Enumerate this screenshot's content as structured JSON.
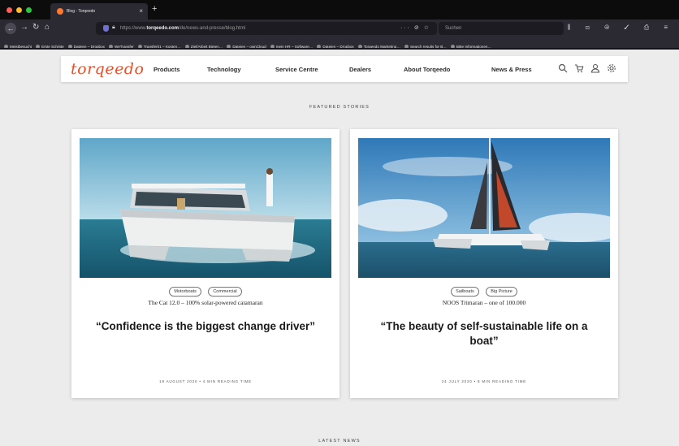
{
  "browser": {
    "tab_title": "Blog - Torqeedo",
    "url_prefix": "https://www.",
    "url_domain": "torqeedo.com",
    "url_path": "/de/news-and-presse/blog.html",
    "url_actions": "··· ⊘ ☆",
    "search_placeholder": "Suchen",
    "new_tab": "+",
    "tab_close": "×",
    "tools": "⫼ ⊡ ⊕ ✓ ⎙ ≡"
  },
  "bookmarks": [
    "Meistbesucht",
    "Erste Schritte",
    "Dateien – Dropbox",
    "WeTransfer",
    "Transfer01 – Kosten…",
    "Ziel/Arbeit Bieten…",
    "Dateien – ownCloud",
    "mein HR – Software…",
    "Dateien – Dropbox",
    "Torqeedo Marketing…",
    "Search results for B…",
    "Bitte Informationen…"
  ],
  "site": {
    "logo": "Torqeedo",
    "nav": [
      "Products",
      "Technology",
      "Service Centre",
      "Dealers",
      "About Torqeedo",
      "News & Press"
    ],
    "featured_label": "FEATURED STORIES",
    "latest_label": "LATEST NEWS"
  },
  "cards": [
    {
      "tags": [
        "Motorboats",
        "Commercial"
      ],
      "subtitle": "The Cat 12.0 – 100% solar-powered catamaran",
      "headline": "“Confidence is the biggest change driver”",
      "meta": "19 AUGUST 2020 • 4 MIN READING TIME"
    },
    {
      "tags": [
        "Sailboats",
        "Big Picture"
      ],
      "subtitle": "NOOS Trimaran – one of 100.000",
      "headline": "“The beauty of self-sustainable life on a boat”",
      "meta": "24 JULY 2020 • 8 MIN READING TIME"
    }
  ],
  "colors": {
    "brand": "#e8502a",
    "page_bg": "#ececec",
    "chrome_dark": "#2b2a33"
  }
}
